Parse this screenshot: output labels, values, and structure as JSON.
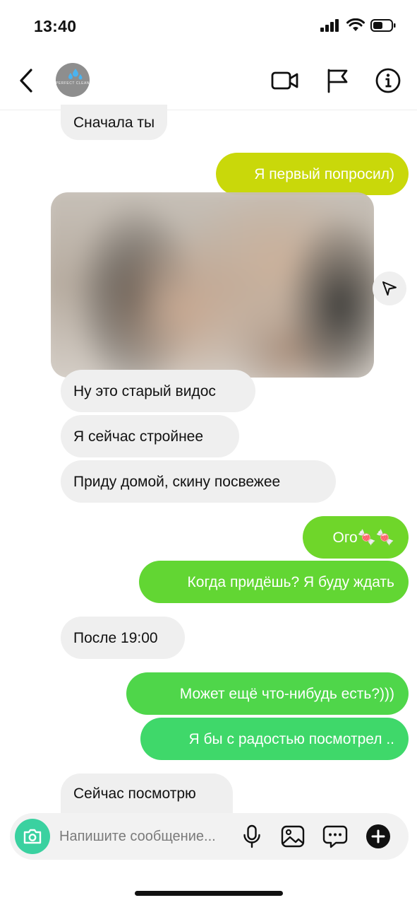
{
  "status_bar": {
    "time": "13:40"
  },
  "contact": {
    "avatar_text": "PERFECT CLEAN"
  },
  "messages": [
    {
      "dir": "in",
      "text": "Сначала ты"
    },
    {
      "dir": "out",
      "text": "Я первый попросил)"
    },
    {
      "dir": "in",
      "text": "Ну это старый видос"
    },
    {
      "dir": "in",
      "text": "Я сейчас стройнее"
    },
    {
      "dir": "in",
      "text": "Приду домой, скину посвежее"
    },
    {
      "dir": "out",
      "text": "Ого🍬🍬"
    },
    {
      "dir": "out",
      "text": "Когда придёшь? Я буду ждать"
    },
    {
      "dir": "in",
      "text": "После 19:00"
    },
    {
      "dir": "out",
      "text": "Может ещё что-нибудь есть?)))"
    },
    {
      "dir": "out",
      "text": "Я бы с радостью посмотрел .."
    },
    {
      "dir": "in",
      "text": "Сейчас посмотрю"
    }
  ],
  "composer": {
    "placeholder": "Напишите сообщение..."
  },
  "icons": {
    "header": [
      "chevron-left-icon",
      "video-call-icon",
      "flag-icon",
      "info-icon"
    ],
    "composer": [
      "camera-icon",
      "microphone-icon",
      "image-icon",
      "sticker-icon",
      "plus-icon"
    ],
    "media": [
      "send-icon"
    ]
  },
  "colors": {
    "outgoing_gradient": [
      "#c9d80a",
      "#6fd62a",
      "#4fd64a",
      "#3fd86a"
    ],
    "incoming_bubble": "#efefef",
    "camera_button": "#3ad1a0"
  }
}
